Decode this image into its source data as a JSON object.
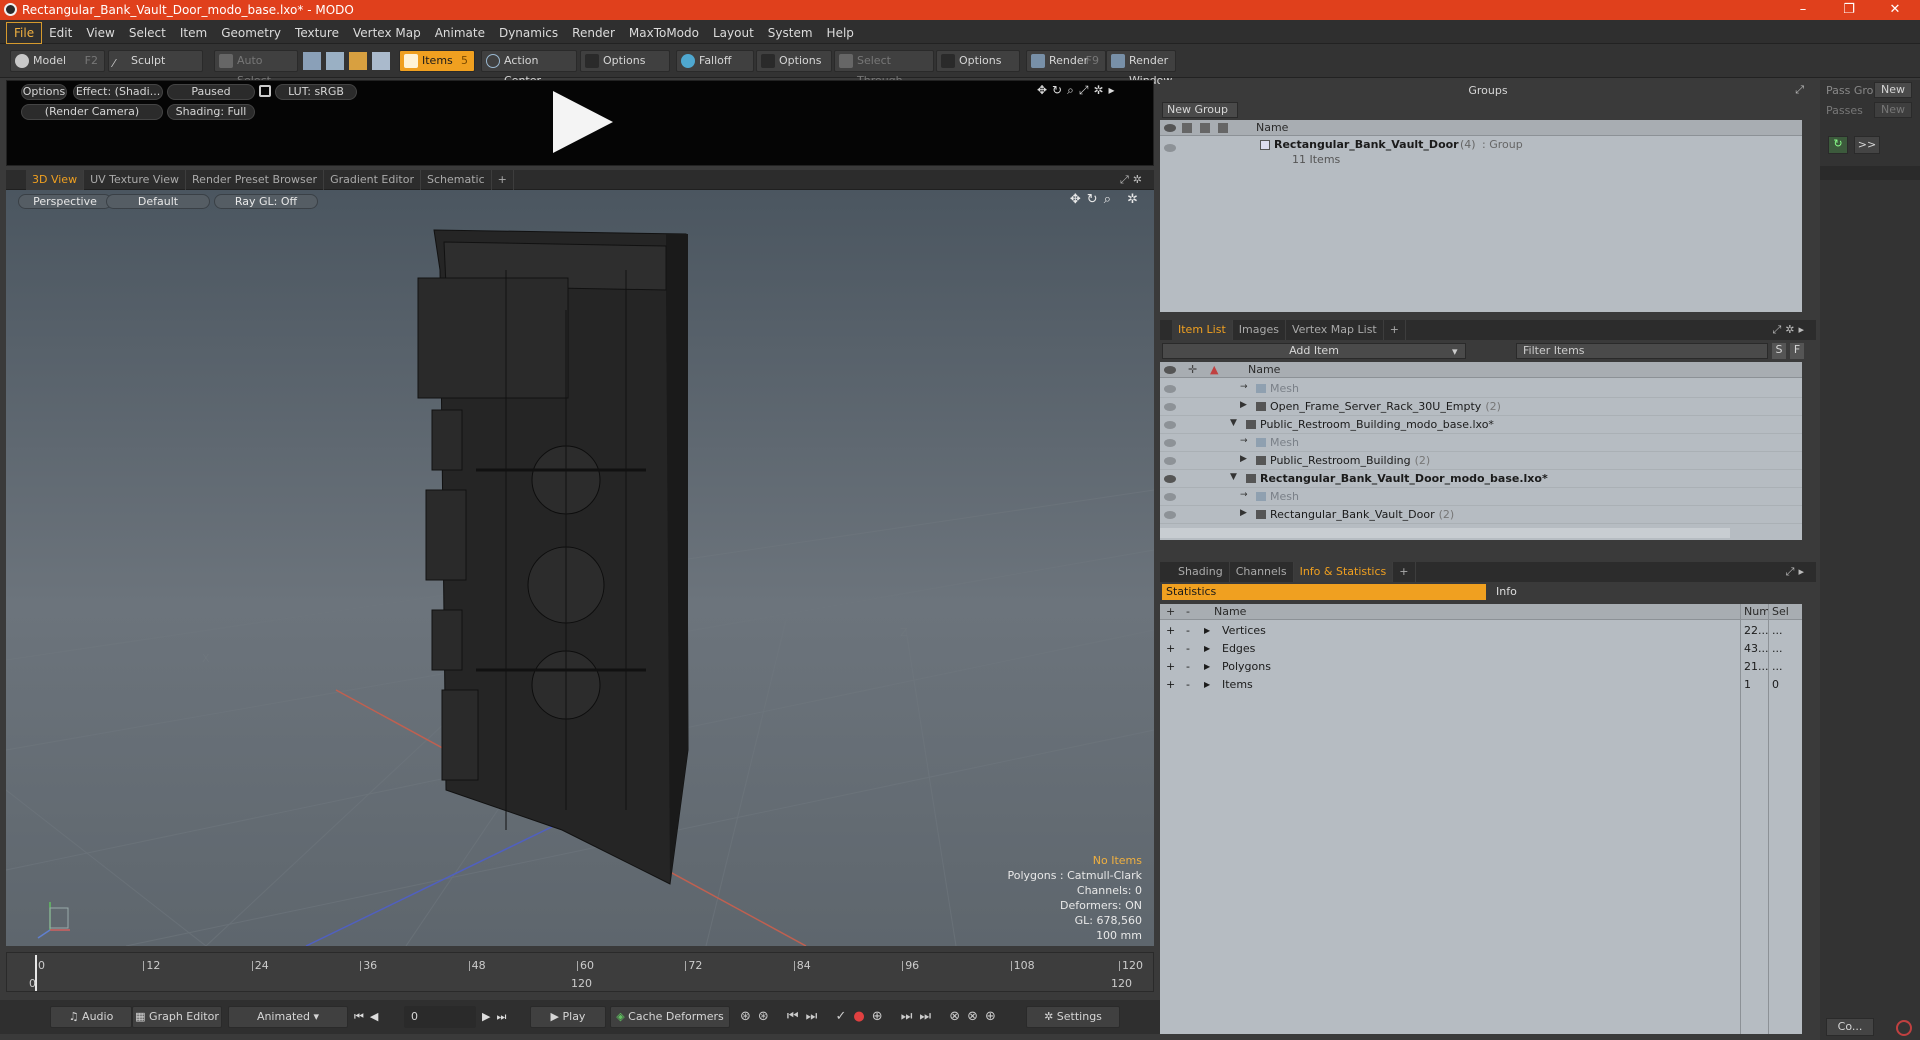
{
  "window": {
    "title": "Rectangular_Bank_Vault_Door_modo_base.lxo* - MODO",
    "min": "–",
    "max": "❐",
    "close": "✕"
  },
  "menu": [
    "File",
    "Edit",
    "View",
    "Select",
    "Item",
    "Geometry",
    "Texture",
    "Vertex Map",
    "Animate",
    "Dynamics",
    "Render",
    "MaxToModo",
    "Layout",
    "System",
    "Help"
  ],
  "toolbar": {
    "model": "Model",
    "model_key": "F2",
    "sculpt": "Sculpt",
    "auto_select": "Auto Select",
    "items": "Items",
    "items_key": "5",
    "action_center": "Action Center",
    "options1": "Options",
    "falloff": "Falloff",
    "options2": "Options",
    "select_through": "Select Through",
    "options3": "Options",
    "render": "Render",
    "render_key": "F9",
    "render_window": "Render Window"
  },
  "preview": {
    "options": "Options",
    "effect": "Effect: (Shadi...",
    "paused": "Paused",
    "lut": "LUT: sRGB",
    "camera": "(Render Camera)",
    "shading": "Shading: Full"
  },
  "viewport_tabs": [
    "3D View",
    "UV Texture View",
    "Render Preset Browser",
    "Gradient Editor",
    "Schematic",
    "+"
  ],
  "viewport": {
    "perspective": "Perspective",
    "default": "Default",
    "raygl": "Ray GL: Off",
    "stats": {
      "items": "No Items",
      "polygons": "Polygons : Catmull-Clark",
      "channels": "Channels: 0",
      "deformers": "Deformers: ON",
      "gl": "GL: 678,560",
      "scale": "100 mm"
    },
    "axis_x": "X",
    "axis_z": "Z"
  },
  "timeline": {
    "ticks": [
      "0",
      "12",
      "24",
      "36",
      "48",
      "60",
      "72",
      "84",
      "96",
      "108",
      "120"
    ],
    "sub_left": "0",
    "sub_mid": "120",
    "sub_right": "120"
  },
  "bottombar": {
    "audio": "Audio",
    "graph_editor": "Graph Editor",
    "animated": "Animated",
    "frame": "0",
    "play": "Play",
    "cache": "Cache Deformers",
    "settings": "Settings"
  },
  "groups": {
    "title": "Groups",
    "new_group": "New Group",
    "col_name": "Name",
    "row_name": "Rectangular_Bank_Vault_Door",
    "row_count": "(4)",
    "row_type": ": Group",
    "row_sub": "11 Items"
  },
  "pass": {
    "pass_groups": "Pass Gro",
    "passes": "Passes",
    "new1": "New",
    "new2": "New",
    "arrows": ">>"
  },
  "itemlist": {
    "tabs": [
      "Item List",
      "Images",
      "Vertex Map List",
      "+"
    ],
    "add_item": "Add Item",
    "filter": "Filter Items",
    "s": "S",
    "f": "F",
    "col_name": "Name",
    "rows": [
      {
        "text": "Mesh",
        "indent": 2,
        "dim": true
      },
      {
        "text": "Open_Frame_Server_Rack_30U_Empty",
        "count": "(2)",
        "indent": 2,
        "dim": false
      },
      {
        "text": "Public_Restroom_Building_modo_base.lxo*",
        "indent": 1,
        "dim": false
      },
      {
        "text": "Mesh",
        "indent": 2,
        "dim": true
      },
      {
        "text": "Public_Restroom_Building",
        "count": "(2)",
        "indent": 2,
        "dim": false
      },
      {
        "text": "Rectangular_Bank_Vault_Door_modo_base.lxo*",
        "indent": 1,
        "dim": false,
        "bold": true
      },
      {
        "text": "Mesh",
        "indent": 2,
        "dim": true
      },
      {
        "text": "Rectangular_Bank_Vault_Door",
        "count": "(2)",
        "indent": 2,
        "dim": false
      }
    ]
  },
  "stats_panel": {
    "tabs": [
      "Shading",
      "Channels",
      "Info & Statistics",
      "+"
    ],
    "statistics": "Statistics",
    "info": "Info",
    "col_name": "Name",
    "col_num": "Num",
    "col_sel": "Sel",
    "rows": [
      {
        "name": "Vertices",
        "num": "22...",
        "sel": "..."
      },
      {
        "name": "Edges",
        "num": "43...",
        "sel": "..."
      },
      {
        "name": "Polygons",
        "num": "21...",
        "sel": "..."
      },
      {
        "name": "Items",
        "num": "1",
        "sel": "0"
      }
    ]
  },
  "colors": {
    "accent": "#f0a020",
    "title": "#e0401c"
  },
  "co_button": "Co..."
}
